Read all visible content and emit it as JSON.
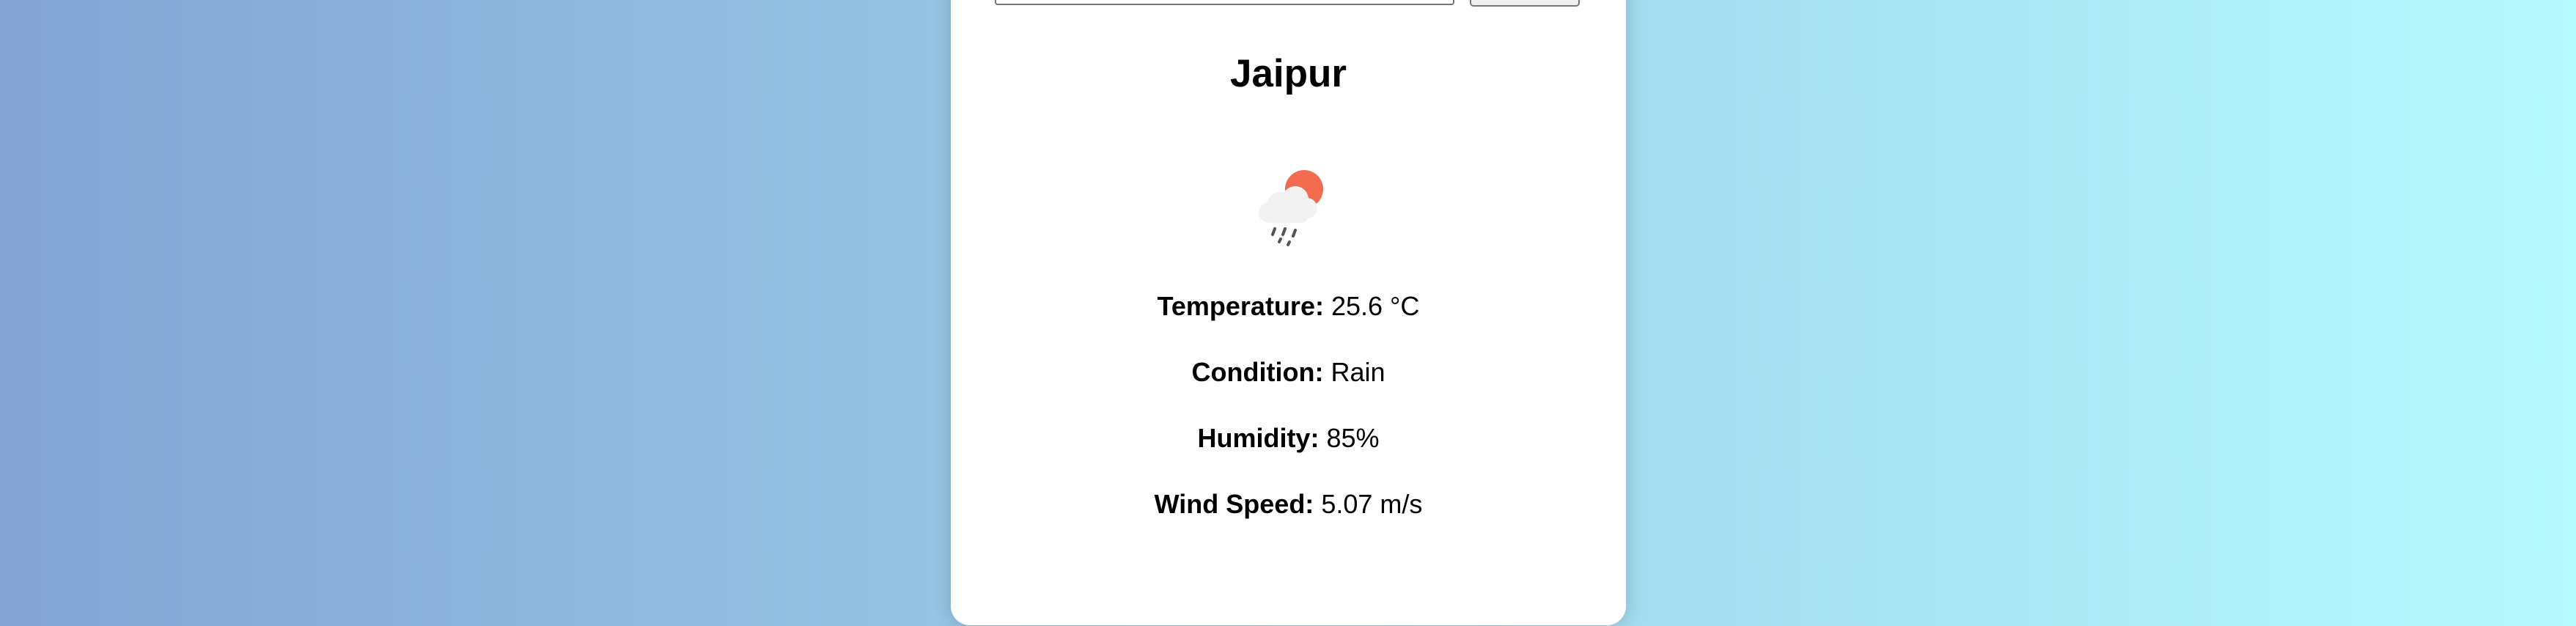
{
  "search": {
    "value": "",
    "placeholder": "",
    "button_label": ""
  },
  "weather": {
    "city": "Jaipur",
    "icon": "rain-with-sun-icon",
    "temperature_label": "Temperature:",
    "temperature_value": "25.6 °C",
    "condition_label": "Condition:",
    "condition_value": "Rain",
    "humidity_label": "Humidity:",
    "humidity_value": "85%",
    "wind_label": "Wind Speed:",
    "wind_value": "5.07 m/s"
  },
  "colors": {
    "gradient_start": "#83a4d4",
    "gradient_end": "#b6fbff",
    "sun": "#f26b4f",
    "cloud": "#f2f2f2",
    "rain": "#555555"
  }
}
